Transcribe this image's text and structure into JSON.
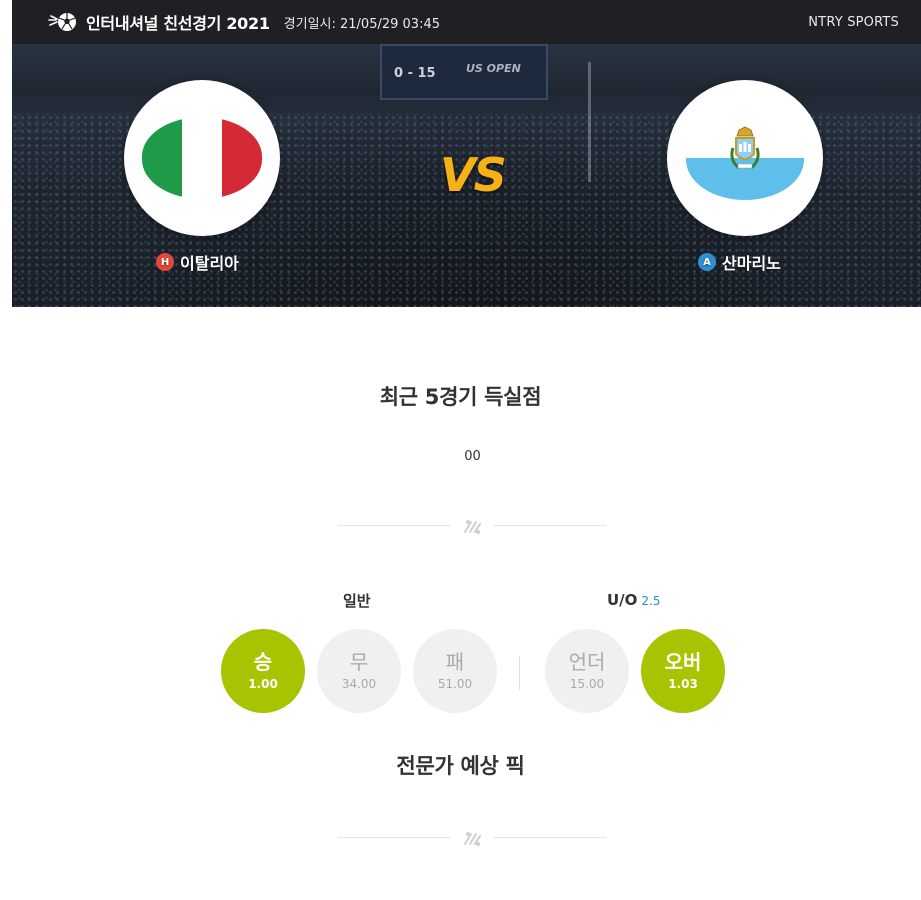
{
  "header": {
    "title": "인터내셔널 친선경기 2021",
    "date": "경기일시: 21/05/29 03:45",
    "brand": "NTRY SPORTS"
  },
  "hero": {
    "scoreboard": "0 - 15",
    "scoreboard_logo": "US OPEN",
    "vs": "VS",
    "home": {
      "badge": "H",
      "name": "이탈리아",
      "badge_color": "#e4483a"
    },
    "away": {
      "badge": "A",
      "name": "산마리노",
      "badge_color": "#2f8fd6"
    }
  },
  "recent": {
    "title": "최근 5경기 득실점",
    "value": "00"
  },
  "odds": {
    "general_label": "일반",
    "uo_label": "U/O",
    "uo_line": "2.5",
    "items": [
      {
        "label": "승",
        "value": "1.00",
        "selected": true
      },
      {
        "label": "무",
        "value": "34.00",
        "selected": false
      },
      {
        "label": "패",
        "value": "51.00",
        "selected": false
      },
      {
        "label": "언더",
        "value": "15.00",
        "selected": false
      },
      {
        "label": "오버",
        "value": "1.03",
        "selected": true
      }
    ]
  },
  "expert": {
    "title": "전문가 예상 픽"
  },
  "colors": {
    "accent_green": "#a8c400",
    "vs_yellow": "#f5b116",
    "topbar": "#1f2024"
  }
}
